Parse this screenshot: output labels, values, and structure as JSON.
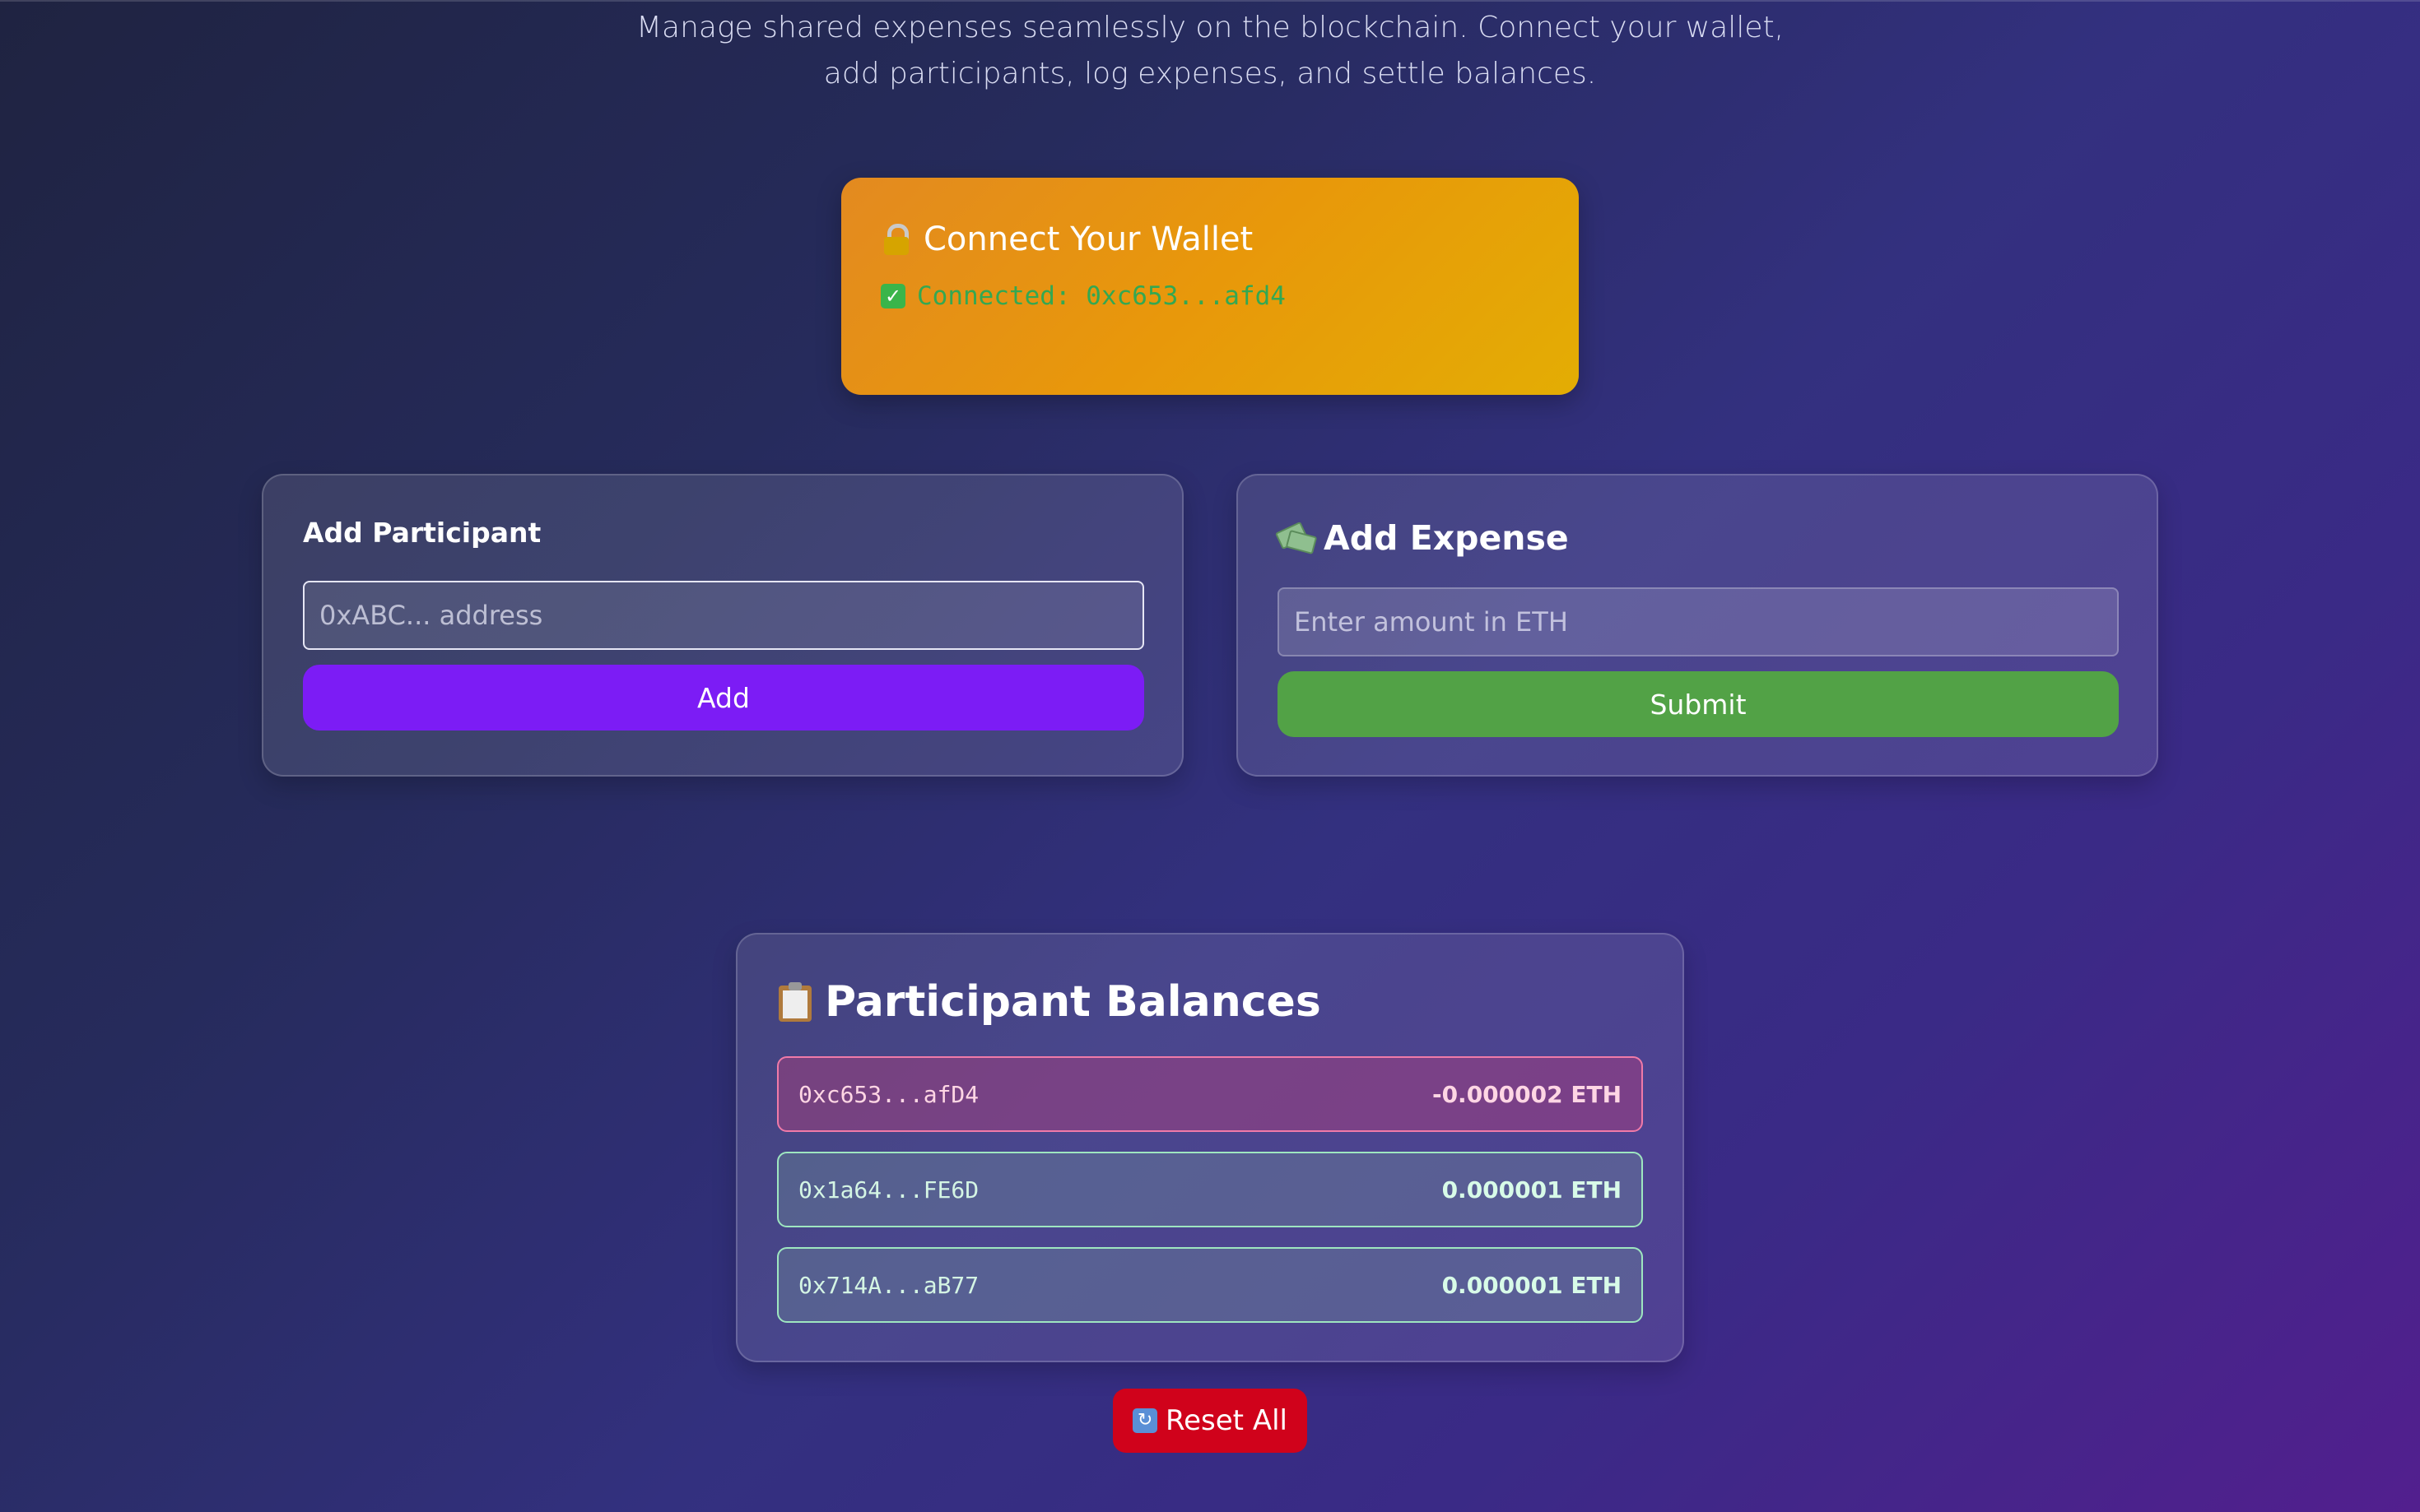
{
  "header": {
    "subtitle": "Manage shared expenses seamlessly on the blockchain. Connect your wallet, add participants, log expenses, and settle balances."
  },
  "wallet": {
    "title": "Connect Your Wallet",
    "status": "Connected: 0xc653...afd4",
    "icon": "locked-with-key-icon",
    "status_icon": "check-mark-icon",
    "accent_colors": [
      "#e38a20",
      "#e3ad04"
    ],
    "status_color": "#33a852"
  },
  "add_participant": {
    "title": "Add Participant",
    "input_value": "",
    "input_placeholder": "0xABC... address",
    "button_label": "Add",
    "button_color": "#7c1cf5"
  },
  "add_expense": {
    "title": "Add Expense",
    "icon": "money-with-wings-icon",
    "input_value": "",
    "input_placeholder": "Enter amount in ETH",
    "button_label": "Submit",
    "button_color": "#52a246"
  },
  "balances": {
    "title": "Participant Balances",
    "icon": "clipboard-icon",
    "rows": [
      {
        "address": "0xc653...afD4",
        "amount": "-0.000002 ETH",
        "status": "negative"
      },
      {
        "address": "0x1a64...FE6D",
        "amount": "0.000001 ETH",
        "status": "positive"
      },
      {
        "address": "0x714A...aB77",
        "amount": "0.000001 ETH",
        "status": "positive"
      }
    ]
  },
  "reset": {
    "label": "Reset All",
    "icon": "refresh-icon",
    "color": "#d0021b"
  }
}
